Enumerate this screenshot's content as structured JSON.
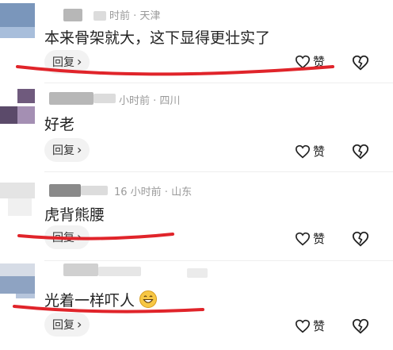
{
  "comments": [
    {
      "meta": "时前 · 天津",
      "text": "本来骨架就大，这下显得更壮实了",
      "reply_label": "回复",
      "like_label": "赞"
    },
    {
      "meta": "小时前 · 四川",
      "text": "好老",
      "reply_label": "回复",
      "like_label": "赞"
    },
    {
      "meta": "16 小时前 · 山东",
      "text": "虎背熊腰",
      "reply_label": "回复",
      "like_label": "赞"
    },
    {
      "meta": "",
      "text": "光着一样吓人",
      "emoji": "grin-emoji",
      "reply_label": "回复",
      "like_label": "赞"
    }
  ],
  "icons": {
    "like": "heart-icon",
    "dislike": "broken-heart-icon",
    "reply_chevron": "chevron-right-icon"
  },
  "colors": {
    "annotation_red": "#e0242a",
    "meta_gray": "#9a9a9a"
  }
}
